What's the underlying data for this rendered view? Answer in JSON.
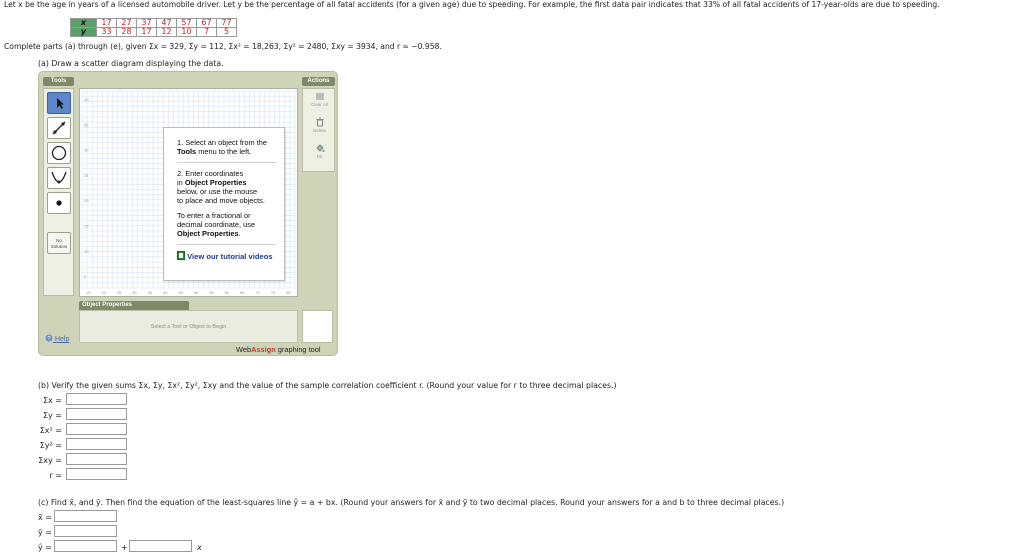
{
  "problem": {
    "intro": "Let x be the age in years of a licensed automobile driver. Let y be the percentage of all fatal accidents (for a given age) due to speeding. For example, the first data pair indicates that 33% of all fatal accidents of 17-year-olds are due to speeding.",
    "table": {
      "x_label": "x",
      "y_label": "y",
      "x_values": [
        "17",
        "27",
        "37",
        "47",
        "57",
        "67",
        "77"
      ],
      "y_values": [
        "33",
        "28",
        "17",
        "12",
        "10",
        "7",
        "5"
      ]
    },
    "given": "Complete parts (a) through (e), given Σx = 329, Σy = 112, Σx² = 18,263, Σy² = 2480, Σxy = 3934, and r ≈ −0.958."
  },
  "part_a": {
    "label": "(a) Draw a scatter diagram displaying the data.",
    "tool": {
      "tools_header": "Tools",
      "actions_header": "Actions",
      "actions": [
        "Clear All",
        "Delete",
        "Fill"
      ],
      "no_solution": "No Solution",
      "y_ticks": [
        "40",
        "35",
        "30",
        "25",
        "20",
        "15",
        "10",
        "5"
      ],
      "x_ticks": [
        "15",
        "20",
        "25",
        "30",
        "35",
        "40",
        "45",
        "50",
        "55",
        "60",
        "65",
        "70",
        "75",
        "80"
      ],
      "tip": {
        "step1_a": "1. Select an object from the",
        "step1_b": "Tools",
        "step1_c": "menu to the left.",
        "step2_a": "2. Enter coordinates",
        "step2_b": "in",
        "step2_c": "Object Properties",
        "step2_d": "below, or use the mouse",
        "step2_e": "to place and move objects.",
        "step3_a": "To enter a fractional or",
        "step3_b": "decimal coordinate, use",
        "step3_c": "Object Properties",
        "link": "View our tutorial videos"
      },
      "object_properties_header": "Object Properties",
      "object_properties_hint": "Select a Tool or Object to Begin",
      "help": "Help",
      "brand_web": "Web",
      "brand_assign": "Assign",
      "brand_suffix": "graphing tool"
    }
  },
  "part_b": {
    "label": "(b) Verify the given sums Σx, Σy, Σx², Σy², Σxy and the value of the sample correlation coefficient r. (Round your value for r to three decimal places.)",
    "fields": [
      {
        "label": "Σx =",
        "value": ""
      },
      {
        "label": "Σy =",
        "value": ""
      },
      {
        "label": "Σx² =",
        "value": ""
      },
      {
        "label": "Σy² =",
        "value": ""
      },
      {
        "label": "Σxy =",
        "value": ""
      },
      {
        "label": "r =",
        "value": ""
      }
    ]
  },
  "part_c": {
    "label": "(c) Find x̄, and ȳ. Then find the equation of the least-squares line ŷ = a + bx. (Round your answers for x̄ and ȳ to two decimal places. Round your answers for a and b to three decimal places.)",
    "xbar_label": "x̄ =",
    "ybar_label": "ȳ =",
    "yhat_label": "ŷ =",
    "plus": "+",
    "x_var": "x",
    "xbar_value": "",
    "ybar_value": "",
    "a_value": "",
    "b_value": ""
  },
  "colors": {
    "table_header": "#5aa06a",
    "data_red": "#d0202a",
    "tool_frame": "#cfd3b8",
    "tool_header": "#7f8868",
    "grid_line": "#cfe0f3",
    "selected_tool": "#5d87c9",
    "link_blue": "#1f3c88"
  }
}
